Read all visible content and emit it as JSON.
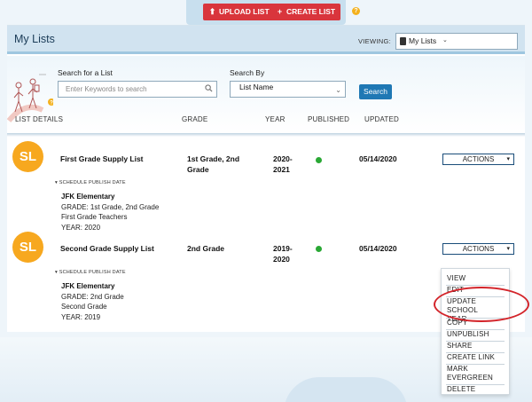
{
  "topbar": {
    "upload_label": "UPLOAD LIST",
    "create_label": "CREATE LIST",
    "help_icon": "question-circle-icon"
  },
  "header": {
    "title": "My Lists",
    "viewing_label": "VIEWING:",
    "viewing_value": "My Lists"
  },
  "search": {
    "label": "Search for a List",
    "placeholder": "Enter Keywords to search",
    "by_label": "Search By",
    "by_value": "List Name",
    "button": "Search"
  },
  "columns": {
    "details": "LIST DETAILS",
    "grade": "GRADE",
    "year": "YEAR",
    "published": "PUBLISHED",
    "updated": "UPDATED"
  },
  "rows": [
    {
      "avatar": "SL",
      "name": "First Grade Supply List",
      "grade_line1": "1st Grade, 2nd",
      "grade_line2": "Grade",
      "year_line1": "2020-",
      "year_line2": "2021",
      "updated": "05/14/2020",
      "actions": "ACTIONS",
      "schedule": "SCHEDULE PUBLISH DATE",
      "school": "JFK Elementary",
      "detail_grade": "GRADE: 1st Grade, 2nd Grade",
      "detail_group": "First Grade Teachers",
      "detail_year": "YEAR: 2020",
      "published_color": "#2aa835"
    },
    {
      "avatar": "SL",
      "name": "Second Grade Supply List",
      "grade_line1": "2nd Grade",
      "grade_line2": "",
      "year_line1": "2019-",
      "year_line2": "2020",
      "updated": "05/14/2020",
      "actions": "ACTIONS",
      "schedule": "SCHEDULE PUBLISH DATE",
      "school": "JFK Elementary",
      "detail_grade": "GRADE: 2nd Grade",
      "detail_group": "Second Grade",
      "detail_year": "YEAR: 2019",
      "published_color": "#2aa835"
    }
  ],
  "menu": {
    "items": [
      "VIEW",
      "EDIT",
      "UPDATE SCHOOL",
      "YEAR",
      "COPY",
      "UNPUBLISH",
      "SHARE",
      "CREATE LINK",
      "MARK",
      "EVERGREEN",
      "DELETE"
    ]
  },
  "colors": {
    "accent": "#d9353c",
    "brand_blue": "#1f78b4",
    "avatar": "#f7a81f",
    "annotation": "#d3242a"
  }
}
